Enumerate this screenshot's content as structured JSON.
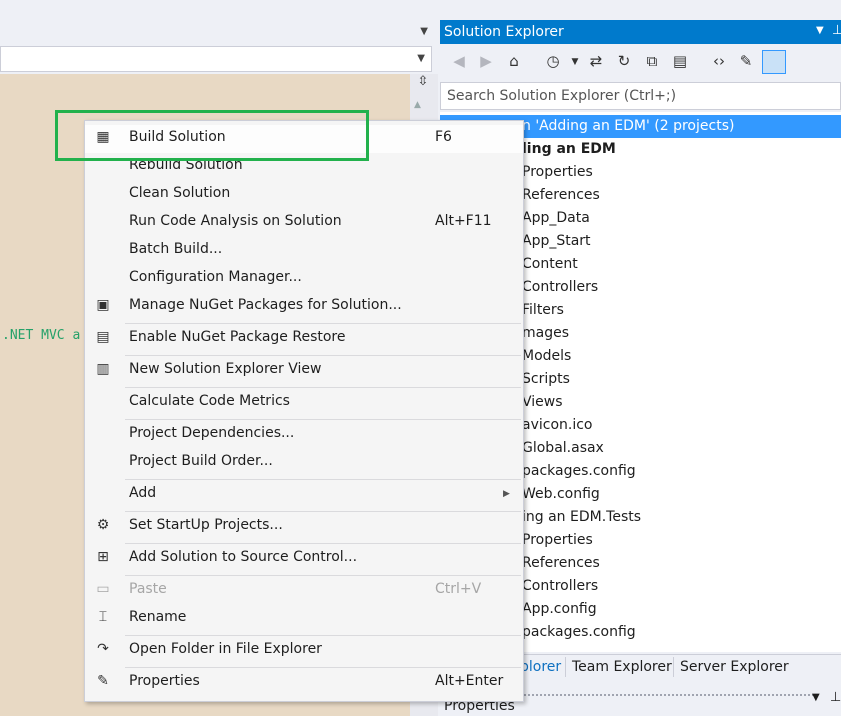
{
  "editor": {
    "code_snippet": ".NET MVC a"
  },
  "solution_explorer": {
    "title": "Solution Explorer",
    "search_placeholder": "Search Solution Explorer (Ctrl+;)",
    "tree": [
      "n 'Adding an EDM' (2 projects)",
      "ling an EDM",
      "Properties",
      "References",
      "App_Data",
      "App_Start",
      "Content",
      "Controllers",
      "Filters",
      "mages",
      "Models",
      "Scripts",
      "Views",
      "avicon.ico",
      "Global.asax",
      "packages.config",
      "Web.config",
      "ing an EDM.Tests",
      "Properties",
      "References",
      "Controllers",
      "App.config",
      "packages.config"
    ],
    "tabs": [
      "plorer",
      "Team Explorer",
      "Server Explorer"
    ],
    "properties_title": "Properties"
  },
  "context_menu": {
    "items": [
      {
        "label": "Build Solution",
        "shortcut": "F6",
        "icon": "build-icon"
      },
      {
        "label": "Rebuild Solution",
        "shortcut": ""
      },
      {
        "label": "Clean Solution",
        "shortcut": ""
      },
      {
        "label": "Run Code Analysis on Solution",
        "shortcut": "Alt+F11"
      },
      {
        "label": "Batch Build...",
        "shortcut": ""
      },
      {
        "label": "Configuration Manager...",
        "shortcut": ""
      },
      {
        "label": "Manage NuGet Packages for Solution...",
        "shortcut": "",
        "icon": "nuget-icon"
      },
      {
        "label": "Enable NuGet Package Restore",
        "shortcut": "",
        "icon": "restore-icon"
      },
      {
        "label": "New Solution Explorer View",
        "shortcut": "",
        "icon": "new-view-icon"
      },
      {
        "label": "Calculate Code Metrics",
        "shortcut": ""
      },
      {
        "label": "Project Dependencies...",
        "shortcut": ""
      },
      {
        "label": "Project Build Order...",
        "shortcut": ""
      },
      {
        "label": "Add",
        "shortcut": ""
      },
      {
        "label": "Set StartUp Projects...",
        "shortcut": "",
        "icon": "gear-icon"
      },
      {
        "label": "Add Solution to Source Control...",
        "shortcut": "",
        "icon": "source-control-icon"
      },
      {
        "label": "Paste",
        "shortcut": "Ctrl+V",
        "icon": "paste-icon",
        "disabled": true
      },
      {
        "label": "Rename",
        "shortcut": "",
        "icon": "rename-icon"
      },
      {
        "label": "Open Folder in File Explorer",
        "shortcut": "",
        "icon": "open-folder-icon"
      },
      {
        "label": "Properties",
        "shortcut": "Alt+Enter",
        "icon": "wrench-icon"
      }
    ]
  },
  "colors": {
    "accent": "#007acc",
    "selection": "#3399ff",
    "highlight_box": "#22b14c",
    "editor_bg": "#e8d9c4"
  }
}
